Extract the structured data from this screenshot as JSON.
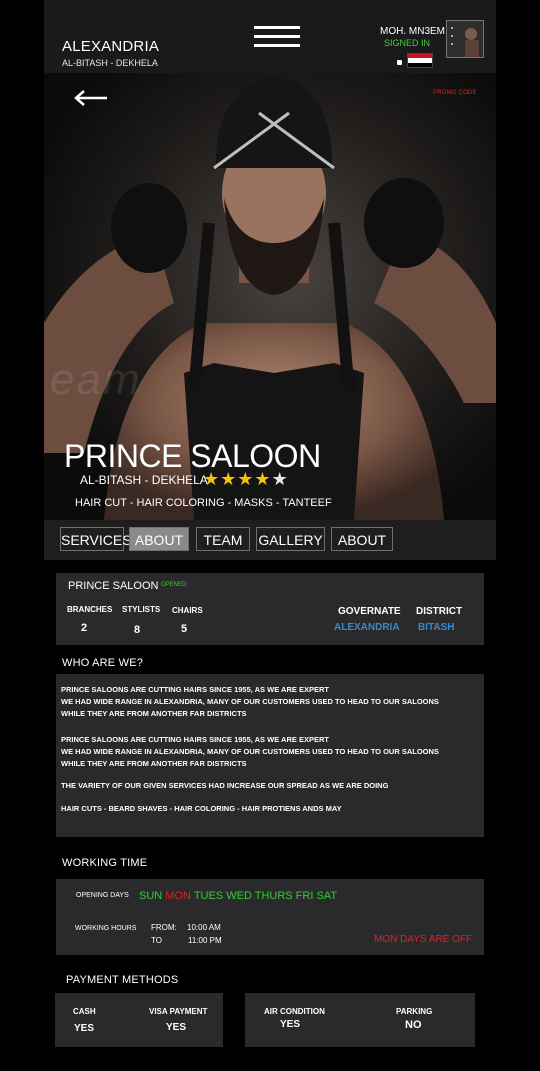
{
  "header": {
    "city": "ALEXANDRIA",
    "district": "AL-BITASH - DEKHELA",
    "user_name": "MOH. MN3EM",
    "user_status": "SIGNED IN",
    "flag_colors": [
      "#ce1126",
      "#ffffff",
      "#000000"
    ]
  },
  "hero": {
    "promo": "PROMO CODE",
    "title": "PRINCE SALOON",
    "district": "AL-BITASH - DEKHELA",
    "rating": 4,
    "stars": "★★★★★",
    "services": "HAIR CUT - HAIR COLORING - MASKS - TANTEEF",
    "watermark": "eam"
  },
  "tabs": [
    "SERVICES",
    "ABOUT",
    "TEAM",
    "GALLERY",
    "ABOUT"
  ],
  "info": {
    "name": "PRINCE SALOON",
    "status": "OPENED",
    "branches_label": "BRANCHES",
    "branches": "2",
    "stylists_label": "STYLISTS",
    "stylists": "8",
    "chairs_label": "CHAIRS",
    "chairs": "5",
    "governate_label": "GOVERNATE",
    "governate": "ALEXANDRIA",
    "district_label": "DISTRICT",
    "district": "BITASH"
  },
  "about": {
    "title": "WHO ARE WE?",
    "p1a": "PRINCE SALOONS ARE CUTTING HAIRS SINCE 1955,  AS WE ARE EXPERT",
    "p1b": "WE HAD WIDE RANGE IN ALEXANDRIA, MANY OF OUR CUSTOMERS USED TO HEAD TO OUR SALOONS",
    "p1c": "WHILE THEY ARE FROM ANOTHER FAR DISTRICTS",
    "p2a": "PRINCE SALOONS ARE CUTTING HAIRS SINCE 1955,  AS WE ARE EXPERT",
    "p2b": "WE HAD WIDE RANGE IN ALEXANDRIA, MANY OF OUR CUSTOMERS USED TO HEAD TO OUR SALOONS",
    "p2c": "WHILE THEY ARE FROM ANOTHER FAR DISTRICTS",
    "p3": "THE VARIETY OF OUR GIVEN SERVICES HAD INCREASE OUR SPREAD AS WE ARE DOING",
    "p4": "HAIR CUTS - BEARD SHAVES - HAIR COLORING - HAIR PROTIENS ANDS MAY"
  },
  "working": {
    "title": "WORKING TIME",
    "days_label": "OPENING DAYS",
    "day_sun": "SUN",
    "day_mon": "MON",
    "day_rest": "TUES WED THURS FRI SAT",
    "hours_label": "WORKING HOURS",
    "from_label": "FROM:",
    "from": "10:00 AM",
    "to_label": "TO",
    "to": "11:00 PM",
    "off_note": "MON DAYS ARE OFF"
  },
  "payment": {
    "title": "PAYMENT METHODS",
    "cash_label": "CASH",
    "cash": "YES",
    "visa_label": "VISA PAYMENT",
    "visa": "YES",
    "ac_label": "AIR CONDITION",
    "ac": "YES",
    "parking_label": "PARKING",
    "parking": "NO"
  }
}
